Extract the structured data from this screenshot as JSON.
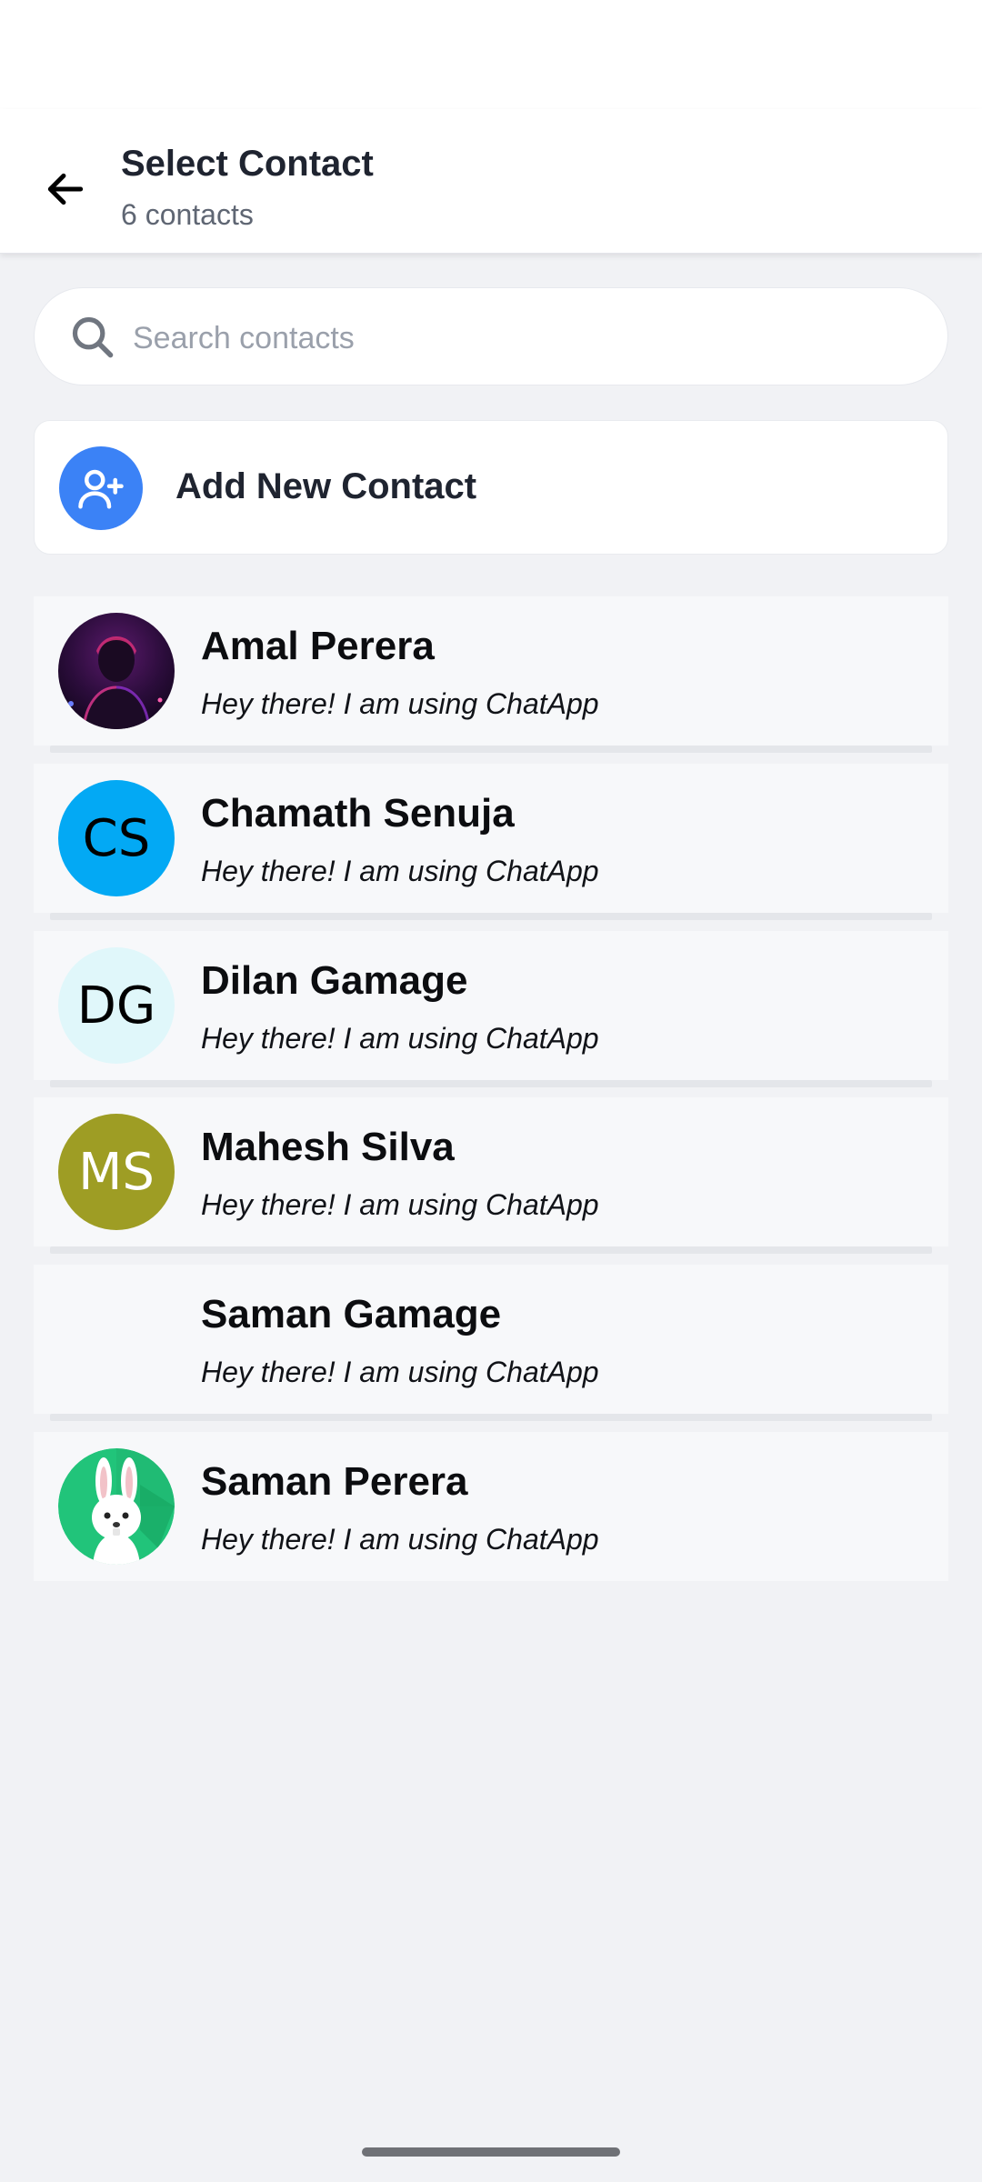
{
  "header": {
    "title": "Select Contact",
    "subtitle": "6 contacts",
    "back_icon": "arrow-left-icon"
  },
  "search": {
    "placeholder": "Search contacts",
    "value": "",
    "icon": "search-icon"
  },
  "add_contact": {
    "label": "Add New Contact",
    "icon": "user-plus-icon",
    "accent_color": "#3b82f6"
  },
  "contacts": [
    {
      "name": "Amal Perera",
      "status": "Hey there! I am using ChatApp",
      "avatar": {
        "type": "photo",
        "description": "person-photo"
      }
    },
    {
      "name": "Chamath Senuja",
      "status": "Hey there! I am using ChatApp",
      "avatar": {
        "type": "initials",
        "initials": "CS",
        "bg": "#03a9f4",
        "fg": "#000000"
      }
    },
    {
      "name": "Dilan Gamage",
      "status": "Hey there! I am using ChatApp",
      "avatar": {
        "type": "initials",
        "initials": "DG",
        "bg": "#e0f7fa",
        "fg": "#000000"
      }
    },
    {
      "name": "Mahesh Silva",
      "status": "Hey there! I am using ChatApp",
      "avatar": {
        "type": "initials",
        "initials": "MS",
        "bg": "#9e9d24",
        "fg": "#ffffff"
      }
    },
    {
      "name": "Saman Gamage",
      "status": "Hey there! I am using ChatApp",
      "avatar": {
        "type": "none"
      }
    },
    {
      "name": "Saman Perera",
      "status": "Hey there! I am using ChatApp",
      "avatar": {
        "type": "illustration",
        "description": "rabbit-illustration"
      }
    }
  ]
}
